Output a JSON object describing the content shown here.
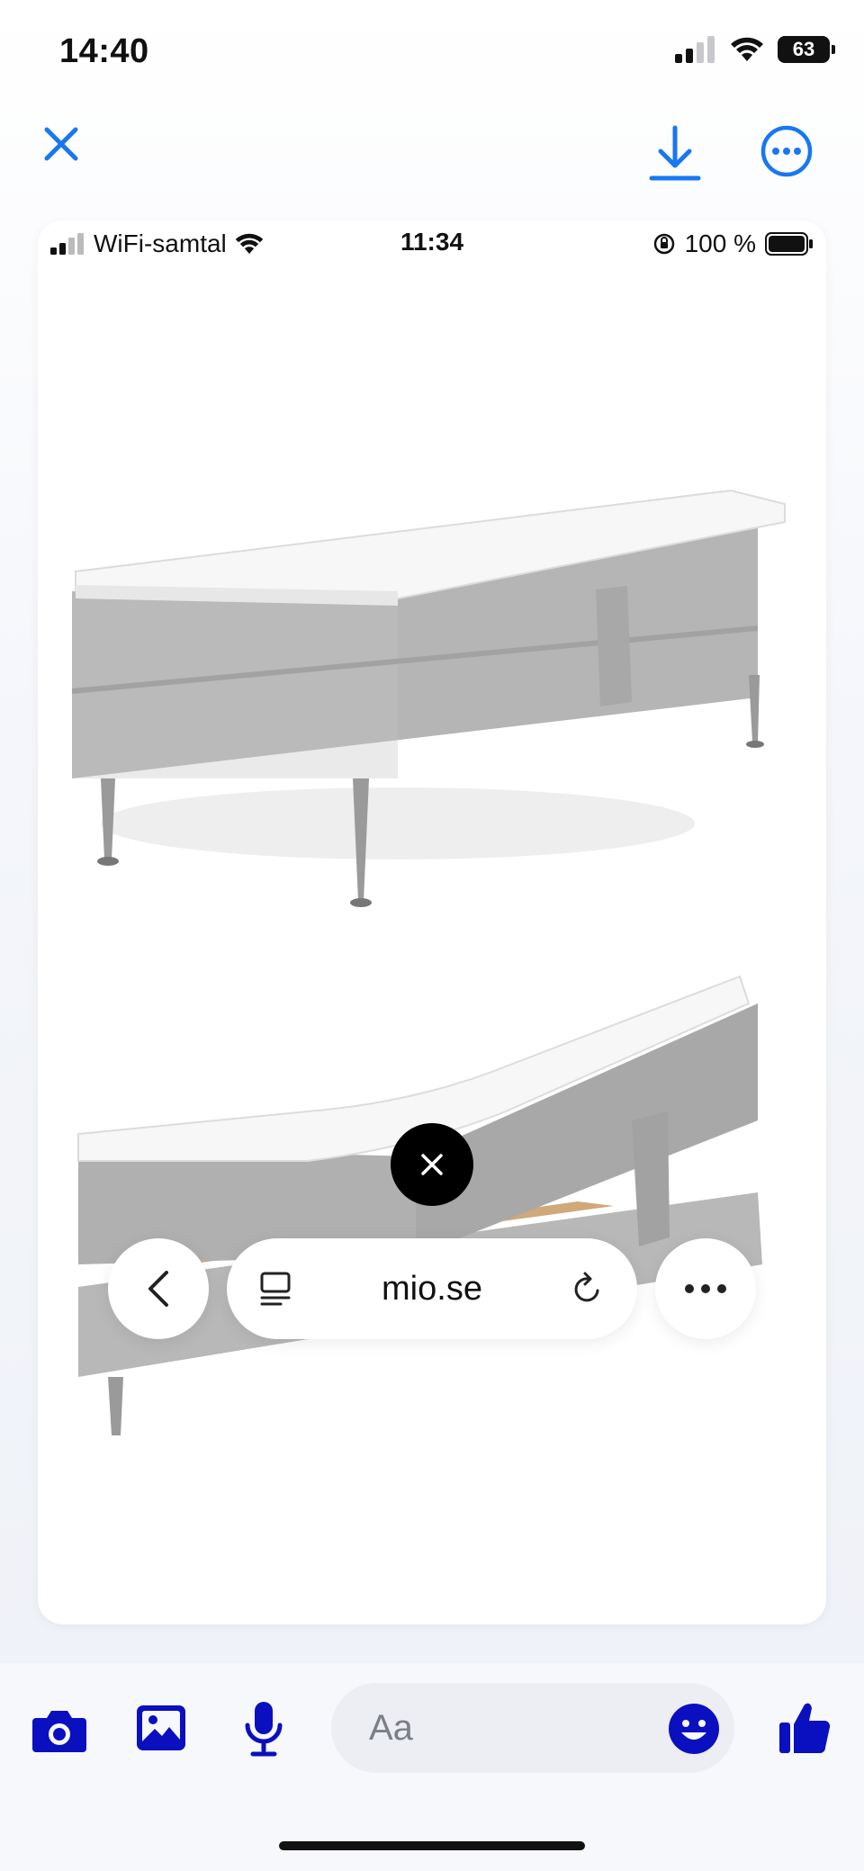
{
  "status_bar": {
    "time": "14:40",
    "battery": "63"
  },
  "toolbar": {
    "close_icon": "close-icon",
    "download_icon": "download-icon",
    "more_icon": "more-icon",
    "accent": "#1877f2"
  },
  "screenshot": {
    "status": {
      "carrier": "WiFi-samtal",
      "time": "11:34",
      "battery": "100 %"
    },
    "url": "mio.se"
  },
  "composer": {
    "placeholder": "Aa",
    "accent": "#0a0fbf"
  }
}
